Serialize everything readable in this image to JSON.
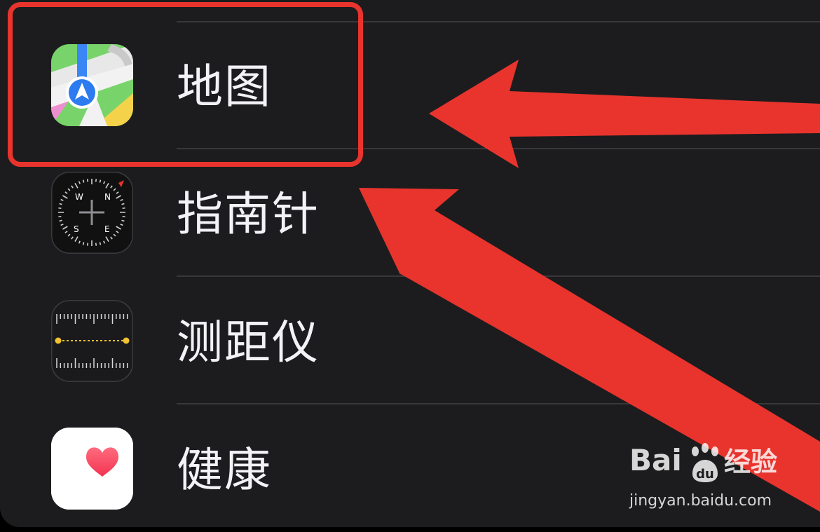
{
  "settings_list": {
    "items": [
      {
        "label": "地图",
        "icon": "maps-icon"
      },
      {
        "label": "指南针",
        "icon": "compass-icon"
      },
      {
        "label": "测距仪",
        "icon": "measure-icon"
      },
      {
        "label": "健康",
        "icon": "health-icon"
      }
    ]
  },
  "compass_letters": {
    "w": "W",
    "n": "N",
    "s": "S",
    "e": "E"
  },
  "watermark": {
    "logo_text": "Bai",
    "paw_text": "du",
    "chinese_text": "经验",
    "url": "jingyan.baidu.com"
  },
  "colors": {
    "annotation_red": "#e8342d",
    "panel_background": "#1c1c1e",
    "label_text": "#f2f2f7"
  }
}
